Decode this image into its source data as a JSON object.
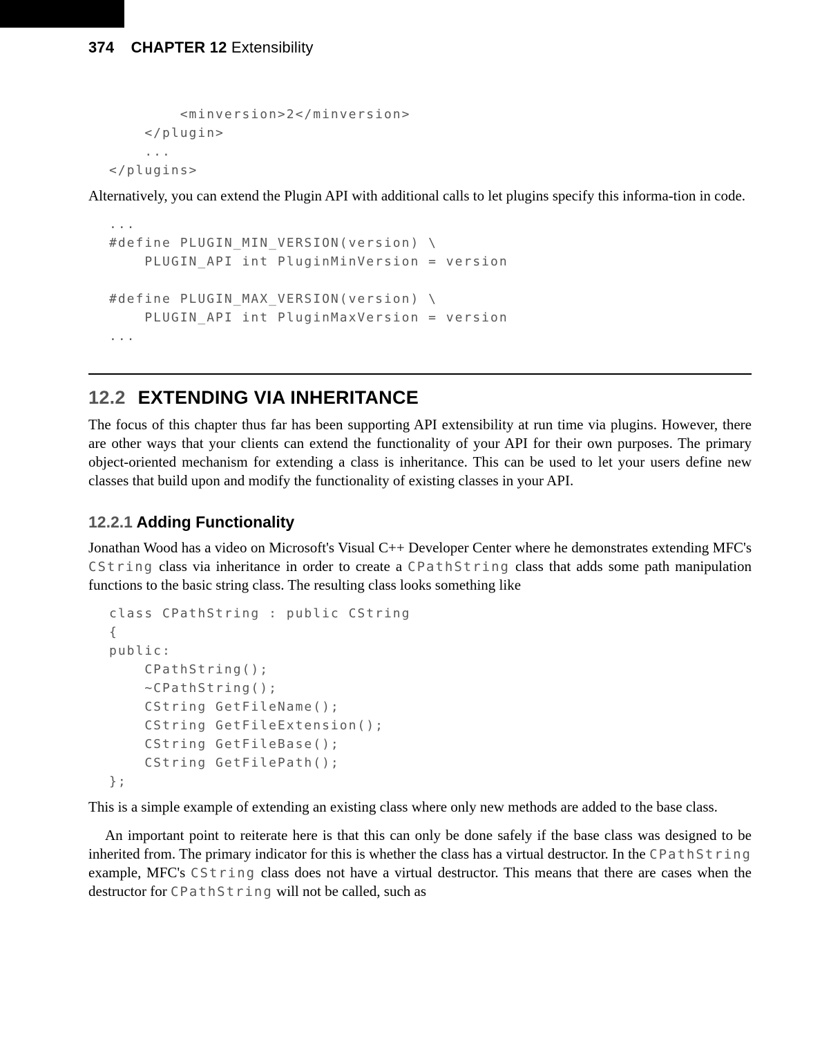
{
  "header": {
    "page_number": "374",
    "chapter_label": "CHAPTER 12",
    "chapter_title": "Extensibility"
  },
  "code_block_1": "        <minversion>2</minversion>\n    </plugin>\n    ...\n</plugins>",
  "para_1_pre": "Alternatively, you can extend the Plugin API with additional calls to let plugins specify this informa",
  "para_1_post": "tion in code.",
  "para_1_hyphen": "-",
  "code_block_2": "...\n#define PLUGIN_MIN_VERSION(version) \\\n    PLUGIN_API int PluginMinVersion = version\n\n#define PLUGIN_MAX_VERSION(version) \\\n    PLUGIN_API int PluginMaxVersion = version\n...",
  "section_12_2": {
    "number": "12.2",
    "title": "EXTENDING VIA INHERITANCE"
  },
  "para_2": "The focus of this chapter thus far has been supporting API extensibility at run time via plugins. However, there are other ways that your clients can extend the functionality of your API for their own purposes. The primary object-oriented mechanism for extending a class is inheritance. This can be used to let your users define new classes that build upon and modify the functionality of existing classes in your API.",
  "section_12_2_1": {
    "number": "12.2.1",
    "title": "Adding Functionality"
  },
  "para_3_a": "Jonathan Wood has a video on Microsoft's Visual C++ Developer Center where he demonstrates extending MFC's ",
  "para_3_code1": "CString",
  "para_3_b": " class via inheritance in order to create a ",
  "para_3_code2": "CPathString",
  "para_3_c": " class that adds some path manipulation functions to the basic string class. The resulting class looks something like",
  "code_block_3": "class CPathString : public CString\n{\npublic:\n    CPathString();\n    ∼CPathString();\n    CString GetFileName();\n    CString GetFileExtension();\n    CString GetFileBase();\n    CString GetFilePath();\n};",
  "para_4": "This is a simple example of extending an existing class where only new methods are added to the base class.",
  "para_5_a": "An important point to reiterate here is that this can only be done safely if the base class was designed to be inherited from. The primary indicator for this is whether the class has a virtual destructor. In the ",
  "para_5_code1": "CPathString",
  "para_5_b": " example, MFC's ",
  "para_5_code2": "CString",
  "para_5_c": " class does not have a virtual destructor. This means that there are cases when the destructor for ",
  "para_5_code3": "CPathString",
  "para_5_d": " will not be called, such as"
}
